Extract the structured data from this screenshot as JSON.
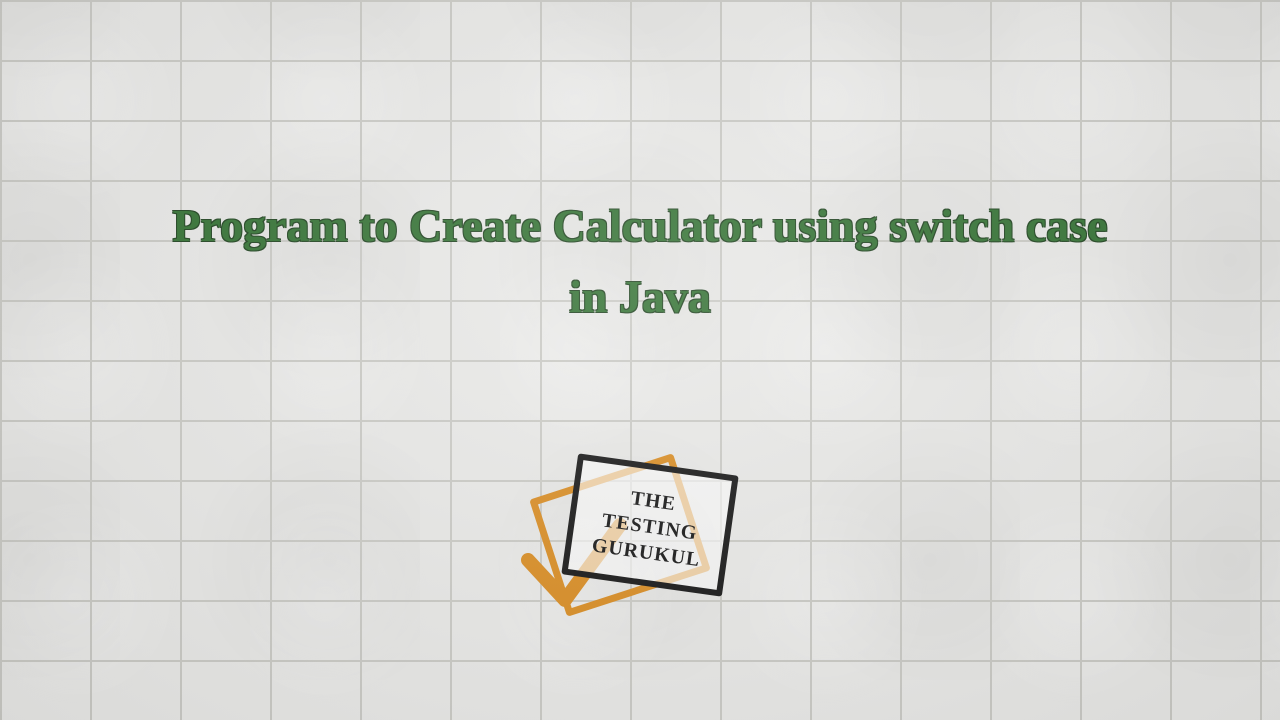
{
  "title_line1": "Program to Create Calculator using switch case",
  "title_line2": "in Java",
  "logo": {
    "line1": "THE",
    "line2": "TESTING",
    "line3": "GURUKUL"
  },
  "colors": {
    "title": "#2f6f2f",
    "logo_accent": "#d88a1e",
    "logo_stroke": "#111111"
  }
}
